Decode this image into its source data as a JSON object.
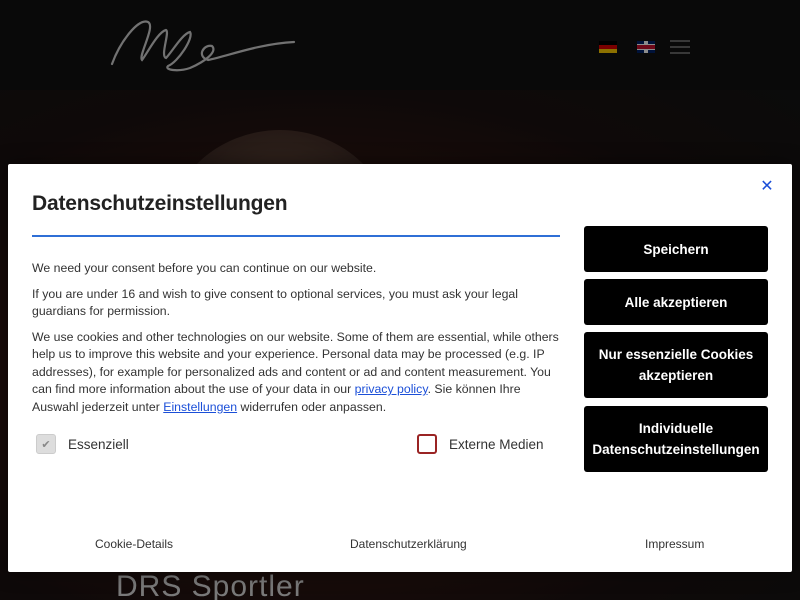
{
  "header": {
    "languages": [
      "de-flag-icon",
      "en-flag-icon"
    ],
    "menu_icon": "hamburger-icon"
  },
  "hero": {
    "title": "DRS Sportler"
  },
  "modal": {
    "title": "Datenschutzeinstellungen",
    "close_icon": "close-icon",
    "paragraph_1": "We need your consent before you can continue on our website.",
    "paragraph_2": "If you are under 16 and wish to give consent to optional services, you must ask your legal guardians for permission.",
    "paragraph_3_start": "We use cookies and other technologies on our website. Some of them are essential, while others help us to improve this website and your experience. Personal data may be processed (e.g. IP addresses), for example for personalized ads and content or ad and content measurement. You can find more information about the use of your data in our ",
    "privacy_link": "privacy policy",
    "paragraph_3_mid": ". Sie können Ihre Auswahl jederzeit unter ",
    "settings_link": "Einstellungen",
    "paragraph_3_end": " widerrufen oder anpassen.",
    "checkboxes": [
      {
        "label": "Essenziell",
        "checked": true,
        "disabled": true
      },
      {
        "label": "Externe Medien",
        "checked": false,
        "disabled": false
      }
    ],
    "buttons": {
      "save": "Speichern",
      "accept_all": "Alle akzeptieren",
      "essential_only": "Nur essenzielle Cookies akzeptieren",
      "individual": "Individuelle Datenschutzeinstellungen"
    },
    "footer_links": {
      "cookie_details": "Cookie-Details",
      "privacy_statement": "Datenschutzerklärung",
      "imprint": "Impressum"
    },
    "colors": {
      "accent": "#2f6fd6",
      "link": "#1b4fd8",
      "button_bg": "#000000",
      "checkbox_border": "#9a2424"
    }
  }
}
